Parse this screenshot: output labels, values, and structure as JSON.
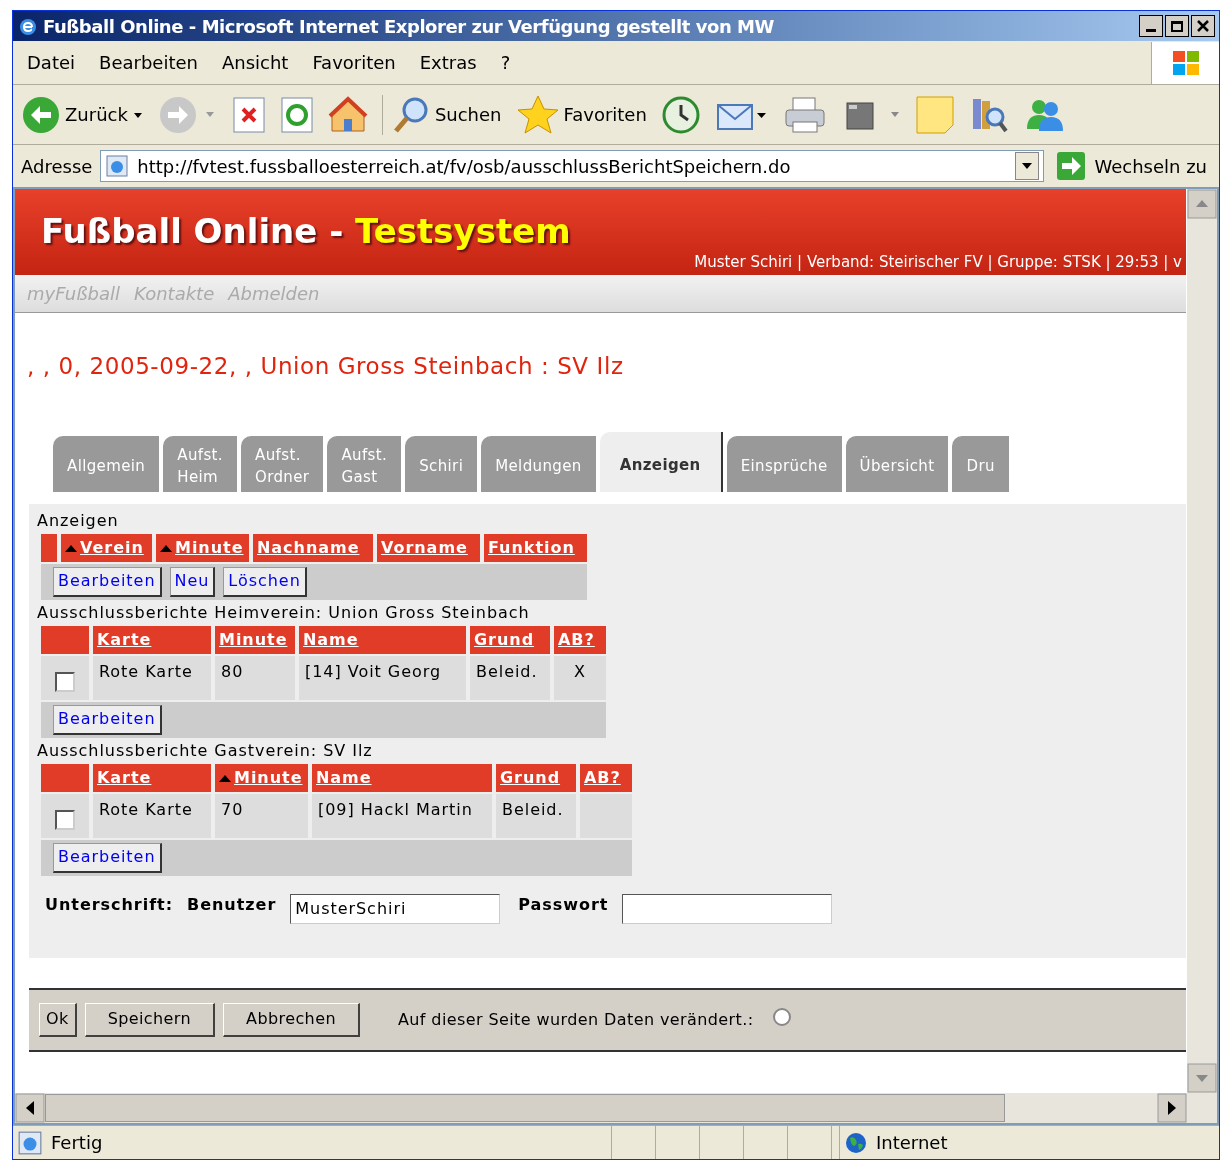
{
  "window": {
    "title": "Fußball Online - Microsoft Internet Explorer  zur Verfügung gestellt von MW"
  },
  "menu": [
    "Datei",
    "Bearbeiten",
    "Ansicht",
    "Favoriten",
    "Extras",
    "?"
  ],
  "toolbar": {
    "back": "Zurück",
    "search": "Suchen",
    "favorites": "Favoriten"
  },
  "address_bar": {
    "label": "Adresse",
    "url": "http://fvtest.fussballoesterreich.at/fv/osb/ausschlussBerichtSpeichern.do",
    "go": "Wechseln zu"
  },
  "header": {
    "title": "Fußball Online - ",
    "highlight": "Testsystem",
    "user_info": "Muster Schiri | Verband: Steirischer FV | Gruppe: STSK | 29:53 | v"
  },
  "nav": [
    "myFußball",
    "Kontakte",
    "Abmelden"
  ],
  "match_title": ", , 0, 2005-09-22, , Union Gross Steinbach : SV Ilz",
  "tabs": [
    {
      "label": "Allgemein",
      "selected": false
    },
    {
      "label": "Aufst.\nHeim",
      "selected": false
    },
    {
      "label": "Aufst.\nOrdner",
      "selected": false
    },
    {
      "label": "Aufst.\nGast",
      "selected": false
    },
    {
      "label": "Schiri",
      "selected": false
    },
    {
      "label": "Meldungen",
      "selected": false
    },
    {
      "label": "Anzeigen",
      "selected": true
    },
    {
      "label": "Einsprüche",
      "selected": false
    },
    {
      "label": "Übersicht",
      "selected": false
    },
    {
      "label": "Dru",
      "selected": false
    }
  ],
  "sections": [
    {
      "title": "Anzeigen",
      "columns": [
        {
          "label": "Verein",
          "sorted": true
        },
        {
          "label": "Minute",
          "sorted": true
        },
        {
          "label": "Nachname",
          "sorted": false
        },
        {
          "label": "Vorname",
          "sorted": false
        },
        {
          "label": "Funktion",
          "sorted": false
        }
      ],
      "buttons": [
        "Bearbeiten",
        "Neu",
        "Löschen"
      ]
    },
    {
      "title": "Ausschlussberichte Heimverein: Union Gross Steinbach",
      "columns": [
        {
          "label": "Karte",
          "sorted": false
        },
        {
          "label": "Minute",
          "sorted": false
        },
        {
          "label": "Name",
          "sorted": false
        },
        {
          "label": "Grund",
          "sorted": false
        },
        {
          "label": "AB?",
          "sorted": false
        }
      ],
      "rows": [
        {
          "checked": false,
          "cells": [
            "Rote Karte",
            "80",
            "[14] Voit Georg",
            "Beleid.",
            "X"
          ]
        }
      ],
      "buttons": [
        "Bearbeiten"
      ]
    },
    {
      "title": "Ausschlussberichte Gastverein: SV Ilz",
      "columns": [
        {
          "label": "Karte",
          "sorted": false
        },
        {
          "label": "Minute",
          "sorted": true
        },
        {
          "label": "Name",
          "sorted": false
        },
        {
          "label": "Grund",
          "sorted": false
        },
        {
          "label": "AB?",
          "sorted": false
        }
      ],
      "rows": [
        {
          "checked": false,
          "cells": [
            "Rote Karte",
            "70",
            "[09] Hackl Martin",
            "Beleid.",
            ""
          ]
        }
      ],
      "buttons": [
        "Bearbeiten"
      ]
    }
  ],
  "signature": {
    "label": "Unterschrift:",
    "user_label": "Benutzer",
    "user_value": "MusterSchiri",
    "password_label": "Passwort"
  },
  "footer": {
    "buttons": [
      "Ok",
      "Speichern",
      "Abbrechen"
    ],
    "changed_label": "Auf dieser Seite wurden Daten verändert.:",
    "changed": false
  },
  "status_bar": {
    "text": "Fertig",
    "zone": "Internet"
  }
}
